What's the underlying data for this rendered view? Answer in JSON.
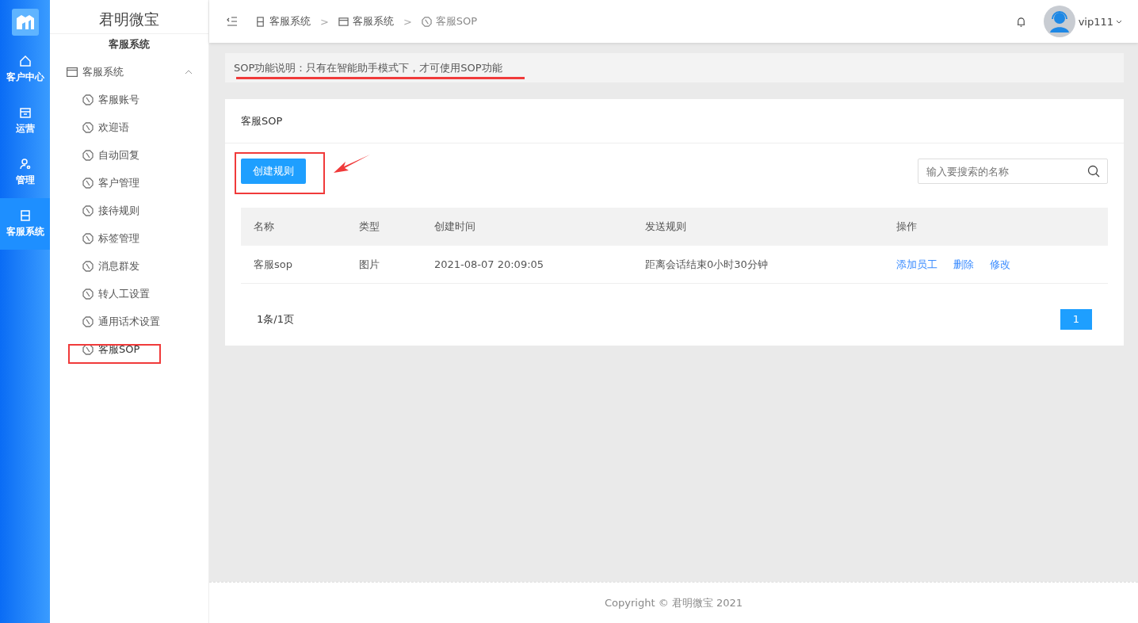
{
  "rail": {
    "items": [
      {
        "label": "客户中心",
        "selected": false
      },
      {
        "label": "运营",
        "selected": false
      },
      {
        "label": "管理",
        "selected": false
      },
      {
        "label": "客服系统",
        "selected": true
      }
    ]
  },
  "sidebar": {
    "title": "君明微宝",
    "subtitle": "客服系统",
    "group": {
      "label": "客服系统",
      "expanded": true,
      "children": [
        {
          "label": "客服账号",
          "selected": false
        },
        {
          "label": "欢迎语",
          "selected": false
        },
        {
          "label": "自动回复",
          "selected": false
        },
        {
          "label": "客户管理",
          "selected": false
        },
        {
          "label": "接待规则",
          "selected": false
        },
        {
          "label": "标签管理",
          "selected": false
        },
        {
          "label": "消息群发",
          "selected": false
        },
        {
          "label": "转人工设置",
          "selected": false
        },
        {
          "label": "通用话术设置",
          "selected": false
        },
        {
          "label": "客服SOP",
          "selected": true
        }
      ]
    }
  },
  "breadcrumb": {
    "items": [
      "客服系统",
      "客服系统",
      "客服SOP"
    ],
    "separators": [
      ">",
      ">"
    ]
  },
  "user": {
    "name": "vip111"
  },
  "notice": "SOP功能说明：只有在智能助手模式下，才可使用SOP功能",
  "card": {
    "title": "客服SOP",
    "create_button": "创建规则",
    "search": {
      "placeholder": "输入要搜索的名称"
    },
    "table": {
      "columns": [
        "名称",
        "类型",
        "创建时间",
        "发送规则",
        "操作"
      ],
      "rows": [
        {
          "cells": [
            "客服sop",
            "图片",
            "2021-08-07 20:09:05",
            "距离会话结束0小时30分钟"
          ],
          "actions": [
            "添加员工",
            "删除",
            "修改"
          ]
        }
      ]
    },
    "pagination": {
      "summary": "1条/1页",
      "pages": [
        {
          "label": "1",
          "selected": true
        }
      ]
    }
  },
  "footer": {
    "copyright": "Copyright © 君明微宝 2021"
  }
}
